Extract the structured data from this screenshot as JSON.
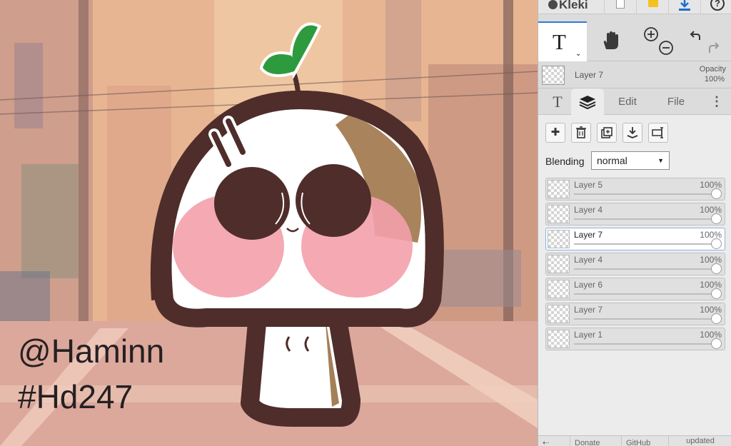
{
  "canvas": {
    "watermark_handle": "@Haminn",
    "watermark_tag": "#Hd247"
  },
  "topbar": {
    "logo_text": "Kleki"
  },
  "tools": {
    "text_tool_glyph": "T",
    "text_tool_caret": "⌄"
  },
  "current_layer": {
    "name": "Layer 7",
    "opacity_label": "Opacity",
    "opacity_value": "100%"
  },
  "tabs": {
    "brush_glyph": "T",
    "edit": "Edit",
    "file": "File",
    "more": "⋮"
  },
  "layers_panel": {
    "buttons": {
      "add": "✚",
      "delete": "🗑",
      "duplicate": "⧉",
      "merge": "⤓",
      "rename": "⌶"
    },
    "blending_label": "Blending",
    "blending_value": "normal",
    "layers": [
      {
        "name": "Layer 5",
        "opacity": "100%",
        "active": false,
        "level": 1.0
      },
      {
        "name": "Layer 4",
        "opacity": "100%",
        "active": false,
        "level": 1.0
      },
      {
        "name": "Layer 7",
        "opacity": "100%",
        "active": true,
        "level": 1.0
      },
      {
        "name": "Layer 4",
        "opacity": "100%",
        "active": false,
        "level": 1.0
      },
      {
        "name": "Layer 6",
        "opacity": "100%",
        "active": false,
        "level": 1.0
      },
      {
        "name": "Layer 7",
        "opacity": "100%",
        "active": false,
        "level": 1.0
      },
      {
        "name": "Layer 1",
        "opacity": "100%",
        "active": false,
        "level": 1.0
      }
    ]
  },
  "bottombar": {
    "back": "⇠",
    "donate": "Donate",
    "github": "GitHub",
    "updated": "updated"
  },
  "colors": {
    "accent": "#2f7bd6",
    "panel_bg": "#dcdcdc",
    "layer_panel_bg": "#ececec",
    "character_outline": "#4e2d2b",
    "character_blush": "#f3a0ab",
    "sprout_green": "#2e9a3e"
  },
  "icons": {
    "hand_tool": "hand-icon",
    "zoom_in": "zoom-in-icon",
    "zoom_out": "zoom-out-icon",
    "undo": "undo-icon",
    "redo": "redo-icon",
    "layers_tab": "layers-icon",
    "save": "download-icon",
    "help": "help-icon"
  }
}
